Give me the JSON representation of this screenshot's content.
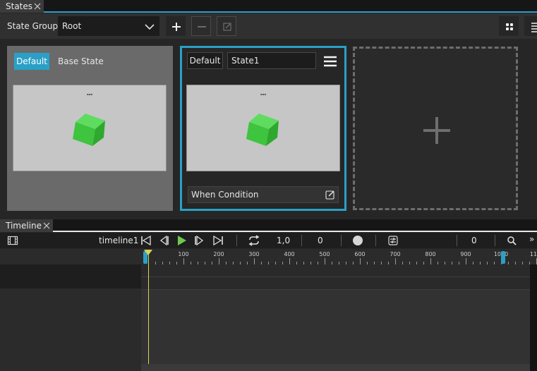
{
  "states_panel": {
    "tab_label": "States",
    "state_group_label": "State Group",
    "state_group_value": "Root",
    "add_label": "+",
    "base_state": {
      "default_label": "Default",
      "name": "Base State"
    },
    "state1": {
      "default_label": "Default",
      "name": "State1",
      "condition_label": "When Condition"
    }
  },
  "timeline_panel": {
    "tab_label": "Timeline",
    "name": "timeline1",
    "speed": "1,0",
    "frame": "0",
    "right_value": "0",
    "more": "»",
    "ruler_labels": [
      "100",
      "200",
      "300",
      "400",
      "500",
      "600",
      "700",
      "800",
      "900",
      "1000",
      "11"
    ]
  },
  "colors": {
    "accent": "#2aa0c8",
    "playhead": "#d8d35a",
    "play_green": "#6fc94d",
    "cube_green": "#3ec43e"
  }
}
